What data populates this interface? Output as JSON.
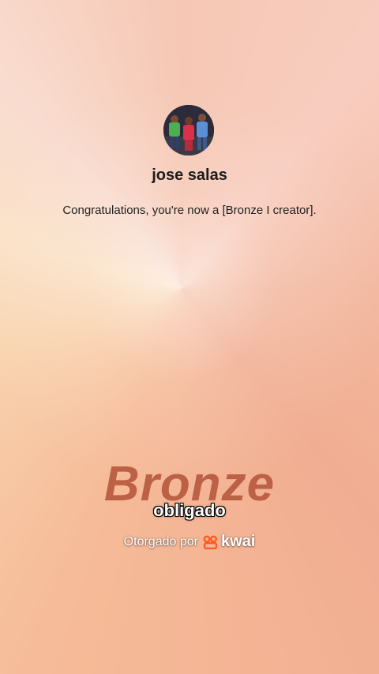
{
  "profile": {
    "name": "jose salas",
    "avatar_icon": "user-avatar-photo"
  },
  "message": {
    "congratulations": "Congratulations, you're now a [Bronze I creator]."
  },
  "badge": {
    "tier": "Bronze",
    "color": "#b85a40"
  },
  "caption": {
    "text": "obligado"
  },
  "awarded": {
    "label": "Otorgado por",
    "brand": "kwai",
    "brand_icon": "kwai-logo-icon",
    "brand_color": "#ff5a1f"
  }
}
